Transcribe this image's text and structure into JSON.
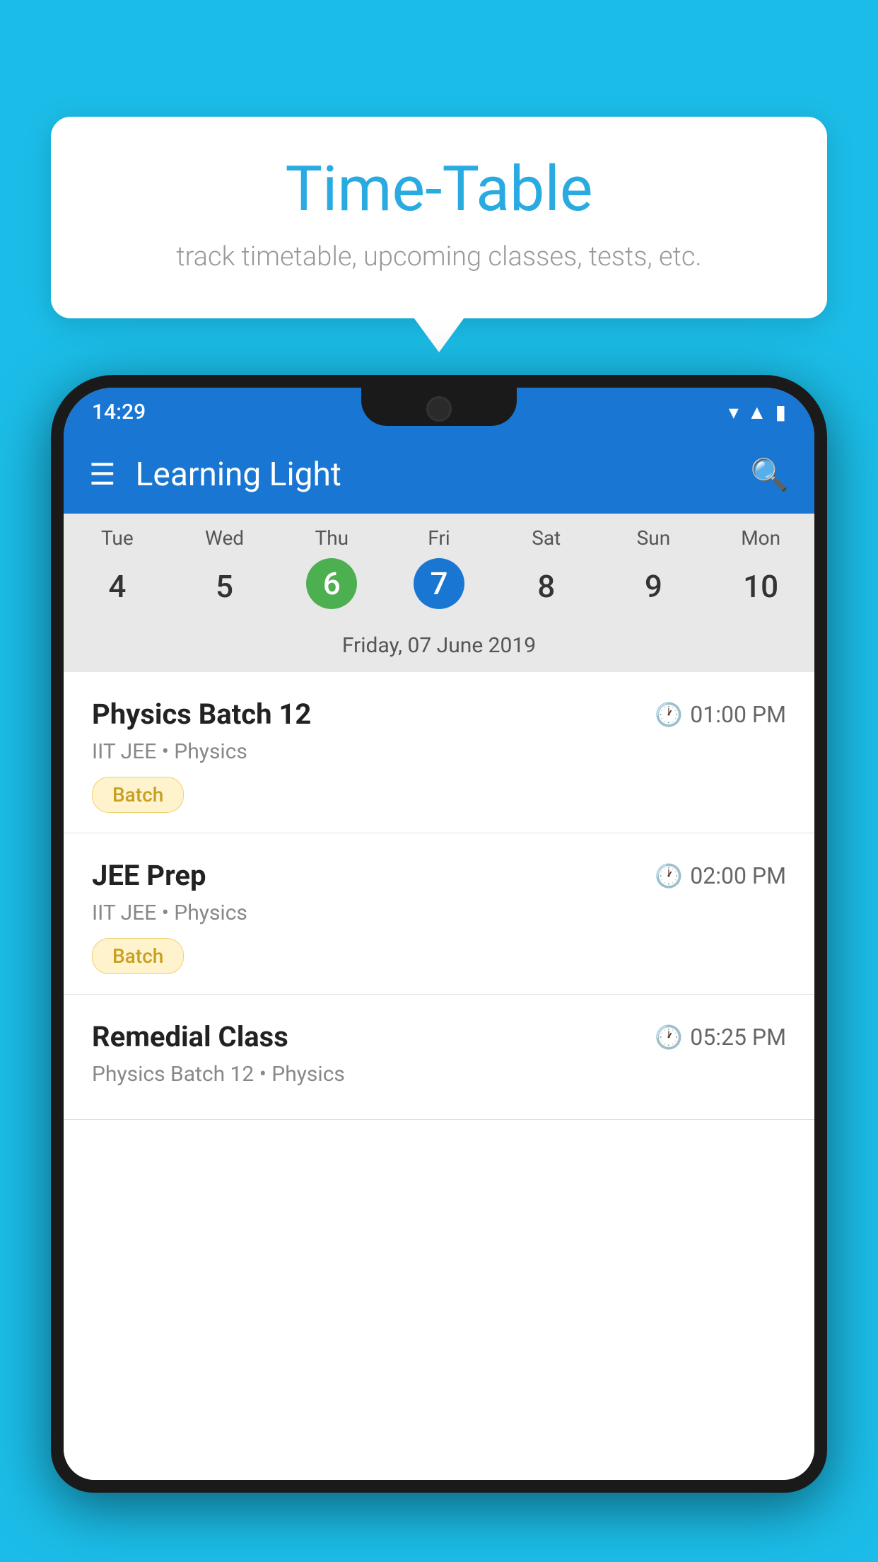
{
  "background": {
    "color": "#1BBDE8"
  },
  "tooltip": {
    "title": "Time-Table",
    "subtitle": "track timetable, upcoming classes, tests, etc."
  },
  "phone": {
    "status_bar": {
      "time": "14:29"
    },
    "app_bar": {
      "title": "Learning Light"
    },
    "calendar": {
      "days": [
        {
          "label": "Tue",
          "num": "4"
        },
        {
          "label": "Wed",
          "num": "5"
        },
        {
          "label": "Thu",
          "num": "6",
          "state": "today"
        },
        {
          "label": "Fri",
          "num": "7",
          "state": "selected"
        },
        {
          "label": "Sat",
          "num": "8"
        },
        {
          "label": "Sun",
          "num": "9"
        },
        {
          "label": "Mon",
          "num": "10"
        }
      ],
      "selected_date": "Friday, 07 June 2019"
    },
    "schedule": [
      {
        "name": "Physics Batch 12",
        "time": "01:00 PM",
        "meta": "IIT JEE • Physics",
        "badge": "Batch"
      },
      {
        "name": "JEE Prep",
        "time": "02:00 PM",
        "meta": "IIT JEE • Physics",
        "badge": "Batch"
      },
      {
        "name": "Remedial Class",
        "time": "05:25 PM",
        "meta": "Physics Batch 12 • Physics",
        "badge": null
      }
    ]
  }
}
